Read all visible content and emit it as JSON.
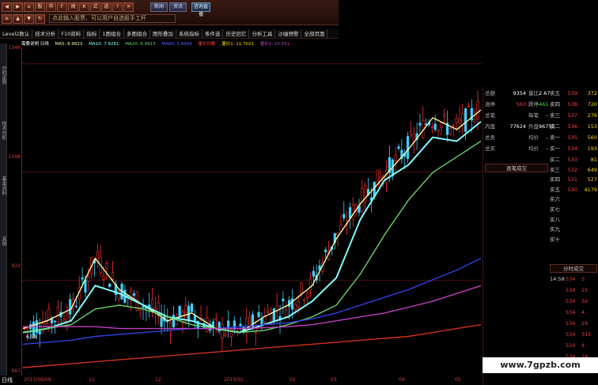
{
  "toolbar": {
    "icons": [
      "back-icon",
      "forward-icon",
      "home-icon",
      "stock-icon",
      "market-icon",
      "f10-icon",
      "news-icon",
      "kline-icon",
      "formula-icon",
      "option-icon",
      "help-icon",
      "exit-icon"
    ],
    "search_placeholder": "点此输入股票、可以用户自选股手工杆",
    "btn_a": "新闻",
    "btn_b": "资讯",
    "btn_c": "咨询直播",
    "zx_label": "新"
  },
  "menubar": {
    "items": [
      "Level2数认",
      "技术分析",
      "F10资料",
      "指标",
      "1图组合",
      "多图组合",
      "图形叠加",
      "系统指标",
      "条件选",
      "历史回忆",
      "分析工具",
      "沙幽预警",
      "全部页面"
    ]
  },
  "indicators": {
    "title": "需要说明 日线",
    "volume": "量价均数",
    "ma5": "MA5: 8.9823",
    "ma10": "MA10: 7.9281",
    "ma20": "MA20: 6.4913",
    "ma60": "MA60: 5.9904",
    "vol_text": "量价均数",
    "vol1": "量价1: 11.7021",
    "vol2": "量价2: 10.931"
  },
  "price_axis": [
    "1346",
    "1098",
    "922",
    "667"
  ],
  "side_tabs": [
    "分时走势",
    "技术分析",
    "基本资料",
    "其他"
  ],
  "date_axis": {
    "day_label": "日线",
    "ticks": [
      "2011/09/09",
      "11",
      "12",
      "2010/01",
      "02",
      "03",
      "04",
      "05"
    ]
  },
  "chart_markers": {
    "low_label": "6.58"
  },
  "chart_data": {
    "type": "candlestick",
    "title": "",
    "note": "K-line (daily candlestick) chart with moving averages",
    "ylim": [
      6.0,
      14.0
    ],
    "categories": [
      "2011/09/09",
      "11",
      "12",
      "2010/01",
      "02",
      "03",
      "04",
      "05"
    ],
    "series": [
      {
        "values": [
          7.0,
          7.2,
          7.5,
          8.8,
          8.0,
          7.6,
          7.2,
          7.4,
          7.0,
          6.9,
          7.3,
          7.6,
          8.1,
          9.3,
          10.2,
          10.9,
          11.6,
          12.4,
          12.1,
          12.6
        ],
        "color": "#f5f5a0"
      },
      {
        "values": [
          6.9,
          7.0,
          7.2,
          8.1,
          7.9,
          7.6,
          7.3,
          7.2,
          7.0,
          6.9,
          7.1,
          7.3,
          7.7,
          8.3,
          9.8,
          10.8,
          11.2,
          11.9,
          11.8,
          12.3
        ],
        "color": "#80ffff"
      },
      {
        "values": [
          6.9,
          7.0,
          7.1,
          7.5,
          7.6,
          7.5,
          7.3,
          7.1,
          7.0,
          6.9,
          6.95,
          7.1,
          7.3,
          7.6,
          8.4,
          9.4,
          10.3,
          11.0,
          11.4,
          11.8
        ],
        "color": "#6ad46a"
      },
      {
        "values": [
          6.6,
          6.65,
          6.7,
          6.8,
          6.85,
          6.9,
          6.95,
          7.0,
          7.0,
          7.05,
          7.1,
          7.15,
          7.25,
          7.4,
          7.6,
          7.8,
          8.0,
          8.25,
          8.5,
          8.8
        ],
        "color": "#3040e0"
      },
      {
        "values": [
          7.05,
          7.05,
          7.05,
          7.05,
          7.0,
          7.0,
          7.0,
          7.0,
          7.0,
          7.0,
          7.02,
          7.05,
          7.1,
          7.2,
          7.3,
          7.4,
          7.55,
          7.7,
          7.9,
          8.1
        ],
        "color": "#c040c0"
      },
      {
        "values": [
          6.0,
          6.05,
          6.1,
          6.15,
          6.2,
          6.25,
          6.3,
          6.35,
          6.4,
          6.45,
          6.5,
          6.55,
          6.6,
          6.65,
          6.7,
          6.75,
          6.8,
          6.9,
          7.0,
          7.1
        ],
        "color": "#d03020"
      }
    ]
  },
  "quote": {
    "rows": [
      {
        "l1": "总额",
        "v1": "9354",
        "l2": "量比",
        "v2": "2.67",
        "s": "卖五",
        "p": "539",
        "q": "372"
      },
      {
        "l1": "涨停",
        "v1": "563",
        "l2": "跌停",
        "v2": "461",
        "s": "卖四",
        "p": "538",
        "q": "720"
      },
      {
        "l1": "总笔",
        "v1": "",
        "l2": "每笔",
        "v2": "-",
        "s": "卖三",
        "p": "537",
        "q": "276"
      },
      {
        "l1": "内盘",
        "v1": "77624",
        "l2": "外盘",
        "v2": "96752",
        "s": "卖二",
        "p": "536",
        "q": "153"
      },
      {
        "l1": "总卖",
        "v1": "",
        "l2": "均价",
        "v2": "-",
        "s": "卖一",
        "p": "535",
        "q": "560"
      },
      {
        "l1": "总买",
        "v1": "",
        "l2": "均价",
        "v2": "-",
        "s": "买一",
        "p": "534",
        "q": "193"
      }
    ],
    "zbtn_label": "逐笔成交",
    "buy_rows": [
      {
        "s": "买二",
        "p": "533",
        "q": "81"
      },
      {
        "s": "买三",
        "p": "532",
        "q": "649"
      },
      {
        "s": "买四",
        "p": "531",
        "q": "527"
      },
      {
        "s": "买五",
        "p": "530",
        "q": "4179"
      },
      {
        "s": "买六",
        "p": "",
        "q": ""
      },
      {
        "s": "买七",
        "p": "",
        "q": ""
      },
      {
        "s": "买八",
        "p": "",
        "q": ""
      },
      {
        "s": "买九",
        "p": "",
        "q": ""
      },
      {
        "s": "买十",
        "p": "",
        "q": ""
      }
    ],
    "fenbi_label": "分时成交",
    "ticks": [
      {
        "t": "14:58",
        "p": "534",
        "v": "3"
      },
      {
        "t": "",
        "p": "534",
        "v": "25"
      },
      {
        "t": "",
        "p": "534",
        "v": "34"
      },
      {
        "t": "",
        "p": "534",
        "v": "4"
      },
      {
        "t": "",
        "p": "534",
        "v": "24"
      },
      {
        "t": "",
        "p": "534",
        "v": "315"
      },
      {
        "t": "",
        "p": "534",
        "v": "4"
      },
      {
        "t": "",
        "p": "534",
        "v": "24"
      },
      {
        "t": "",
        "p": "534",
        "v": "58"
      }
    ]
  },
  "watermark": "www.7gpzb.com"
}
